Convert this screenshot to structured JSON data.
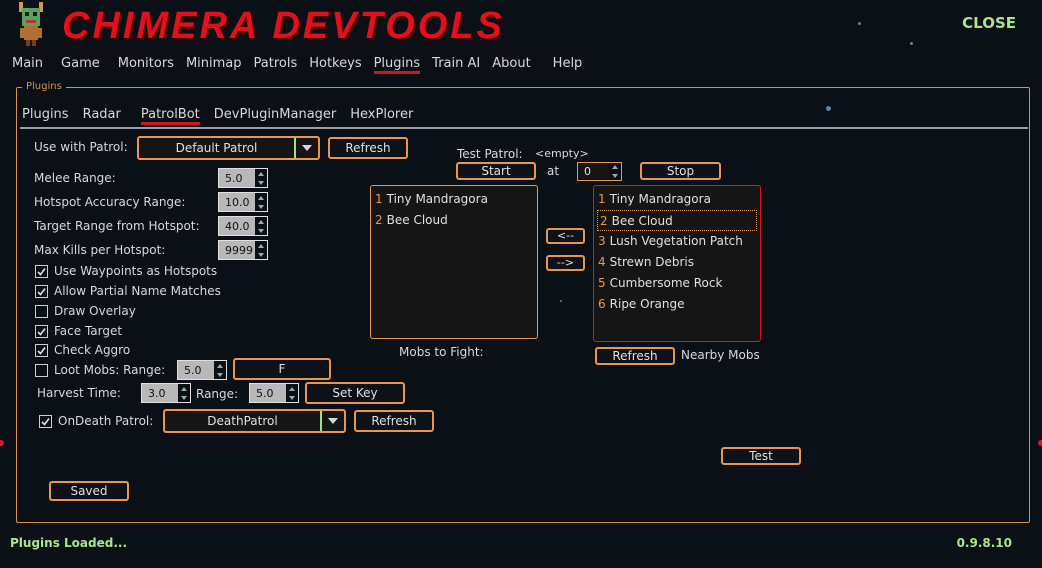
{
  "app": {
    "title": "CHIMERA DEVTOOLS",
    "close_label": "CLOSE",
    "status": "Plugins Loaded...",
    "version": "0.9.8.10",
    "accent": "#e89650",
    "brand": "#e0101c",
    "status_color": "#a9e58a"
  },
  "nav": {
    "tabs": [
      "Main",
      "Game",
      "Monitors",
      "Minimap",
      "Patrols",
      "Hotkeys",
      "Plugins",
      "Train AI",
      "About",
      "Help"
    ],
    "active": "Plugins"
  },
  "plugins": {
    "legend": "Plugins",
    "tabs": [
      "Plugins",
      "Radar",
      "PatrolBot",
      "DevPluginManager",
      "HexPlorer"
    ],
    "active": "PatrolBot"
  },
  "patrolbot": {
    "use_with_patrol_label": "Use with Patrol:",
    "use_with_patrol_value": "Default Patrol",
    "refresh_label": "Refresh",
    "melee_range_label": "Melee Range:",
    "melee_range_value": "5.0",
    "hotspot_accuracy_label": "Hotspot Accuracy Range:",
    "hotspot_accuracy_value": "10.0",
    "target_range_label": "Target Range from Hotspot:",
    "target_range_value": "40.0",
    "max_kills_label": "Max Kills per Hotspot:",
    "max_kills_value": "9999",
    "checkboxes": [
      {
        "label": "Use Waypoints as Hotspots",
        "checked": true
      },
      {
        "label": "Allow Partial Name Matches",
        "checked": true
      },
      {
        "label": "Draw Overlay",
        "checked": false
      },
      {
        "label": "Face Target",
        "checked": true
      },
      {
        "label": "Check Aggro",
        "checked": true
      }
    ],
    "loot_mobs_label": "Loot Mobs: Range:",
    "loot_mobs_checked": false,
    "loot_range_value": "5.0",
    "loot_key_label": "F",
    "harvest_time_label": "Harvest Time:",
    "harvest_time_value": "3.0",
    "range_label": "Range:",
    "range_value": "5.0",
    "set_key_label": "Set Key",
    "ondeath_label": "OnDeath Patrol:",
    "ondeath_checked": true,
    "ondeath_value": "DeathPatrol",
    "ondeath_refresh_label": "Refresh",
    "saved_label": "Saved",
    "test_patrol_label": "Test Patrol:",
    "test_patrol_value": "<empty>",
    "start_label": "Start",
    "at_label": "at",
    "at_value": "0",
    "stop_label": "Stop",
    "mobs_to_fight": [
      "Tiny Mandragora",
      "Bee Cloud"
    ],
    "mobs_to_fight_label": "Mobs to Fight:",
    "remove_label": "<--",
    "add_label": "-->",
    "nearby_mobs": [
      "Tiny Mandragora",
      "Bee Cloud",
      "Lush Vegetation Patch",
      "Strewn Debris",
      "Cumbersome Rock",
      "Ripe Orange"
    ],
    "nearby_selected": "Bee Cloud",
    "nearby_refresh_label": "Refresh",
    "nearby_mobs_label": "Nearby Mobs",
    "test_label": "Test"
  }
}
